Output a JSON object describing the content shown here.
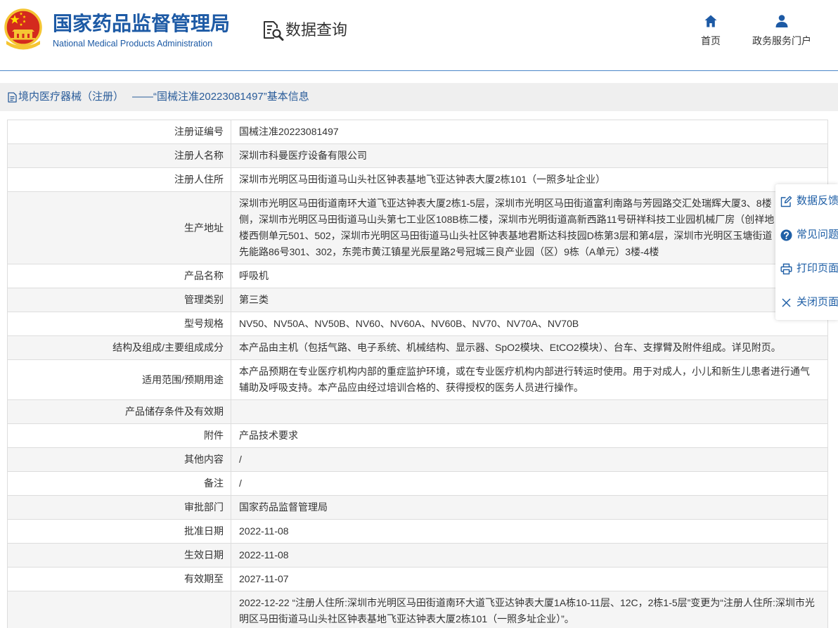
{
  "header": {
    "title_cn": "国家药品监督管理局",
    "title_en": "National Medical Products Administration",
    "emblem_icon": "national-emblem-icon",
    "section": {
      "label": "数据查询",
      "icon": "data-query-icon"
    },
    "nav": [
      {
        "label": "首页",
        "icon": "home-icon"
      },
      {
        "label": "政务服务门户",
        "icon": "user-icon"
      }
    ]
  },
  "breadcrumb": {
    "icon": "document-icon",
    "category": "境内医疗器械（注册）",
    "title": "——“国械注准20223081497”基本信息"
  },
  "details": {
    "rows": [
      {
        "label": "注册证编号",
        "value": "国械注准20223081497"
      },
      {
        "label": "注册人名称",
        "value": "深圳市科曼医疗设备有限公司"
      },
      {
        "label": "注册人住所",
        "value": "深圳市光明区马田街道马山头社区钟表基地飞亚达钟表大厦2栋101（一照多址企业）"
      },
      {
        "label": "生产地址",
        "lines": [
          "深圳市光明区马田街道南环大道飞亚达钟表大厦2栋1-5层，深圳市光明区马田街道富利南路与芳园路交汇处瑞辉大厦3、8楼",
          "侧，深圳市光明区马田街道马山头第七工业区108B栋二楼，深圳市光明街道高新西路11号研祥科技工业园机械厂房（创祥地",
          "楼西侧单元501、502，深圳市光明区马田街道马山头社区钟表基地君斯达科技园D栋第3层和第4层，深圳市光明区玉塘街道",
          "先能路86号301、302，东莞市黄江镇星光辰星路2号冠城三良产业园（区）9栋（A单元）3楼-4楼"
        ]
      },
      {
        "label": "产品名称",
        "value": "呼吸机"
      },
      {
        "label": "管理类别",
        "value": "第三类"
      },
      {
        "label": "型号规格",
        "value": "NV50、NV50A、NV50B、NV60、NV60A、NV60B、NV70、NV70A、NV70B"
      },
      {
        "label": "结构及组成/主要组成成分",
        "value": "本产品由主机（包括气路、电子系统、机械结构、显示器、SpO2模块、EtCO2模块）、台车、支撑臂及附件组成。详见附页。"
      },
      {
        "label": "适用范围/预期用途",
        "value": "本产品预期在专业医疗机构内部的重症监护环境，或在专业医疗机构内部进行转运时使用。用于对成人，小儿和新生儿患者进行通气辅助及呼吸支持。本产品应由经过培训合格的、获得授权的医务人员进行操作。"
      },
      {
        "label": "产品储存条件及有效期"
      },
      {
        "label": "附件",
        "value": "产品技术要求"
      },
      {
        "label": "其他内容",
        "value": "/"
      },
      {
        "label": "备注",
        "value": "/"
      },
      {
        "label": "审批部门",
        "value": "国家药品监督管理局"
      },
      {
        "label": "批准日期",
        "value": "2022-11-08"
      },
      {
        "label": "生效日期",
        "value": "2022-11-08"
      },
      {
        "label": "有效期至",
        "value": "2027-11-07"
      },
      {
        "value": "2022-12-22 “注册人住所:深圳市光明区马田街道南环大道飞亚达钟表大厦1A栋10-11层、12C，2栋1-5层”变更为“注册人住所:深圳市光明区马田街道马山头社区钟表基地飞亚达钟表大厦2栋101（一照多址企业）”。"
      }
    ]
  },
  "side_panel": {
    "items": [
      {
        "label": "数据反馈",
        "icon": "edit-icon"
      },
      {
        "label": "常见问题",
        "icon": "help-icon"
      },
      {
        "label": "打印页面",
        "icon": "print-icon"
      },
      {
        "label": "关闭页面",
        "icon": "close-icon"
      }
    ]
  },
  "colors": {
    "brand_blue": "#1d5aa5",
    "link_blue": "#1f5fa6",
    "title_bar_bg": "#efefef",
    "row_stripe": "#f5f5f5",
    "border": "#dddddd",
    "emblem_red": "#d42a1e",
    "emblem_gold": "#f5c533"
  }
}
